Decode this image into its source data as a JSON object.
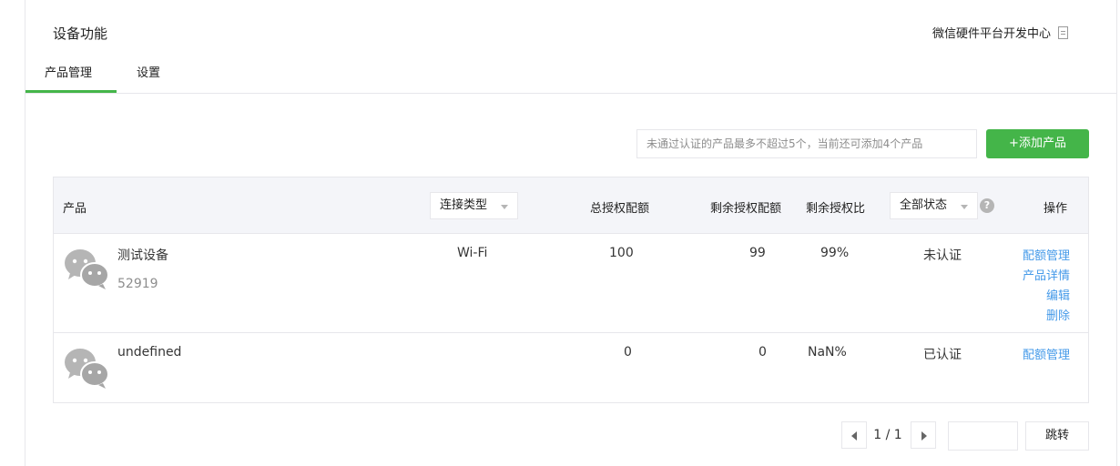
{
  "header": {
    "title": "设备功能",
    "doc_link": "微信硬件平台开发中心"
  },
  "tabs": [
    {
      "label": "产品管理"
    },
    {
      "label": "设置"
    }
  ],
  "notice": "未通过认证的产品最多不超过5个，当前还可添加4个产品",
  "add_button": "+添加产品",
  "table": {
    "headers": {
      "product": "产品",
      "conn_type": "连接类型",
      "total_quota": "总授权配额",
      "remain_quota": "剩余授权配额",
      "remain_ratio": "剩余授权比",
      "status_filter": "全部状态",
      "ops": "操作"
    },
    "rows": [
      {
        "name": "测试设备",
        "id": "52919",
        "conn": "Wi-Fi",
        "total": "100",
        "remain": "99",
        "ratio": "99%",
        "status": "未认证",
        "actions": [
          "配额管理",
          "产品详情",
          "编辑",
          "删除"
        ]
      },
      {
        "name": "undefined",
        "id": "",
        "conn": "",
        "total": "0",
        "remain": "0",
        "ratio": "NaN%",
        "status": "已认证",
        "actions": [
          "配额管理"
        ]
      }
    ]
  },
  "pager": {
    "text": "1 / 1",
    "go_label": "跳转"
  },
  "icons": {
    "help": "question-circle-icon",
    "doc": "document-icon",
    "avatar": "wechat-icon"
  },
  "colors": {
    "accent": "#44b549",
    "link": "#459ae9"
  }
}
